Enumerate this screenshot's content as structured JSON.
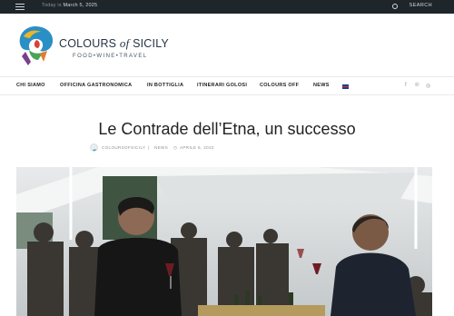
{
  "topbar": {
    "date_prefix": "Today is",
    "date": "March 5, 2025",
    "search_label": "SEARCH"
  },
  "brand": {
    "title_part1": "COLOURS ",
    "title_part2": "of",
    "title_part3": " SICILY",
    "subtitle": "FOOD•WINE•TRAVEL"
  },
  "nav": {
    "items": [
      "CHI SIAMO",
      "OFFICINA GASTRONOMICA",
      "IN BOTTIGLIA",
      "ITINERARI GOLOSI",
      "COLOURS OFF",
      "NEWS"
    ],
    "language_icon": "uk-flag-icon",
    "social_icons": [
      "facebook-icon",
      "pinterest-icon",
      "instagram-icon"
    ]
  },
  "article": {
    "title": "Le Contrade dell’Etna, un successo",
    "author": "COLOURSOFSICILY",
    "category": "NEWS",
    "date": "APRILE 6, 2022"
  },
  "colors": {
    "topbar_bg": "#1f262b",
    "text": "#222222",
    "muted": "#8a8f93",
    "brand": "#253444"
  }
}
